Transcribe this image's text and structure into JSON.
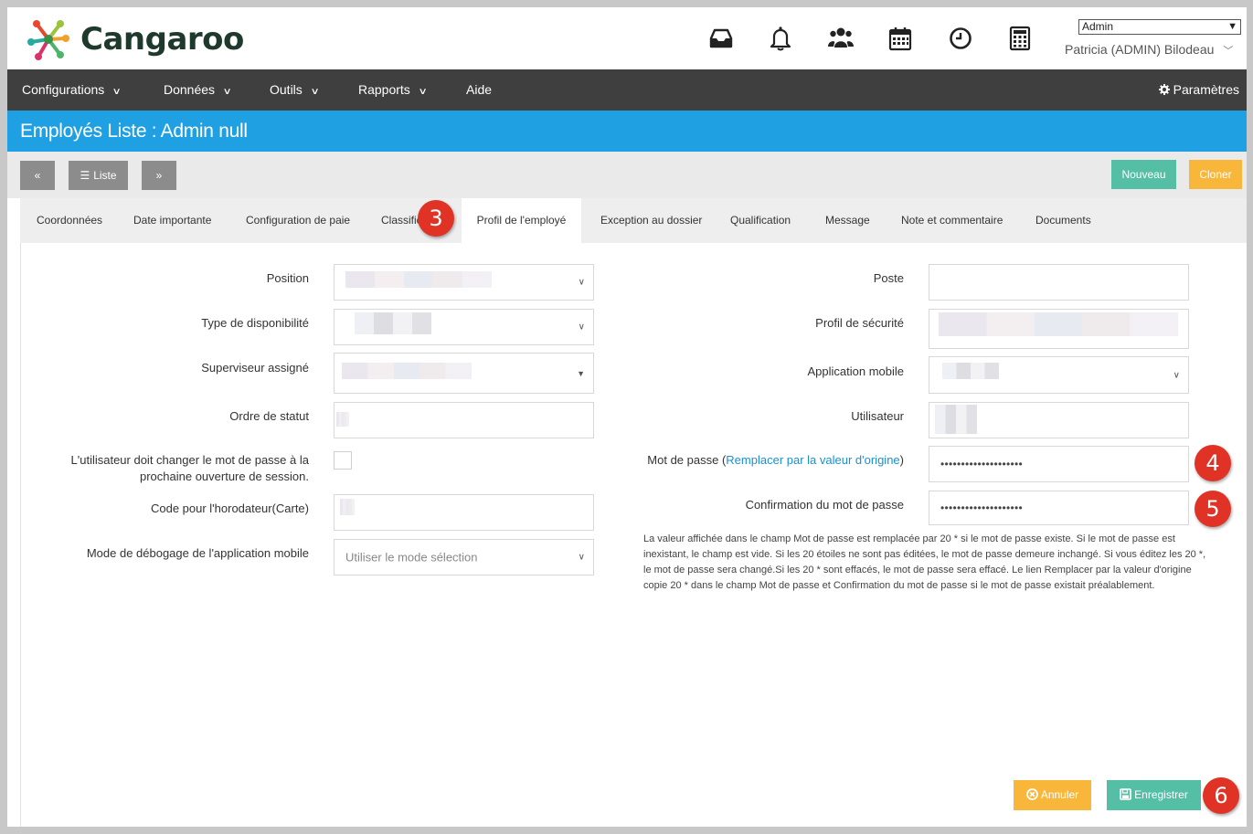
{
  "app": {
    "name": "Cangaroo"
  },
  "header": {
    "icons": [
      "inbox-icon",
      "bell-icon",
      "users-icon",
      "calendar-icon",
      "clock-icon",
      "calculator-icon"
    ],
    "role_select": "Admin",
    "user_name": "Patricia (ADMIN) Bilodeau"
  },
  "nav": {
    "items": [
      "Configurations",
      "Données",
      "Outils",
      "Rapports",
      "Aide"
    ],
    "settings": "Paramètres"
  },
  "page": {
    "title": "Employés Liste : Admin null"
  },
  "toolbar": {
    "prev": "«",
    "list": "Liste",
    "next": "»",
    "new": "Nouveau",
    "clone": "Cloner"
  },
  "tabs": [
    "Coordonnées",
    "Date importante",
    "Configuration de paie",
    "Classific",
    "Profil de l'employé",
    "Exception au dossier",
    "Qualification",
    "Message",
    "Note et commentaire",
    "Documents"
  ],
  "form": {
    "left": {
      "position_label": "Position",
      "availability_label": "Type de disponibilité",
      "supervisor_label": "Superviseur assigné",
      "status_order_label": "Ordre de statut",
      "must_change_pw_label_1": "L'utilisateur doit changer le mot de passe à la",
      "must_change_pw_label_2": "prochaine ouverture de session.",
      "clock_code_label": "Code pour l'horodateur(Carte)",
      "debug_mode_label": "Mode de débogage de l'application mobile",
      "debug_mode_value": "Utiliser le mode sélection"
    },
    "right": {
      "poste_label": "Poste",
      "security_profile_label": "Profil de sécurité",
      "mobile_app_label": "Application mobile",
      "user_label": "Utilisateur",
      "password_label": "Mot de passe (",
      "password_link": "Remplacer par la valeur d'origine",
      "password_label_end": ")",
      "password_value": "••••••••••••••••••••",
      "confirm_label": "Confirmation du mot de passe",
      "confirm_value": "••••••••••••••••••••"
    },
    "note": "La valeur affichée dans le champ Mot de passe est remplacée par 20 * si le mot de passe existe. Si le mot de passe est inexistant, le champ est vide. Si les 20 étoiles ne sont pas éditées, le mot de passe demeure inchangé. Si vous éditez les 20 *, le mot de passe sera changé.Si les 20 * sont effacés, le mot de passe sera effacé. Le lien Remplacer par la valeur d'origine copie 20 * dans le champ Mot de passe et Confirmation du mot de passe si le mot de passe existait préalablement."
  },
  "actions": {
    "cancel": "Annuler",
    "save": "Enregistrer"
  },
  "badges": [
    "3",
    "4",
    "5",
    "6"
  ],
  "colors": {
    "accent_blue": "#1fa0e3",
    "nav_dark": "#3f3f3f",
    "green": "#55bfa5",
    "orange": "#f8b73b",
    "badge_red": "#e03326"
  }
}
